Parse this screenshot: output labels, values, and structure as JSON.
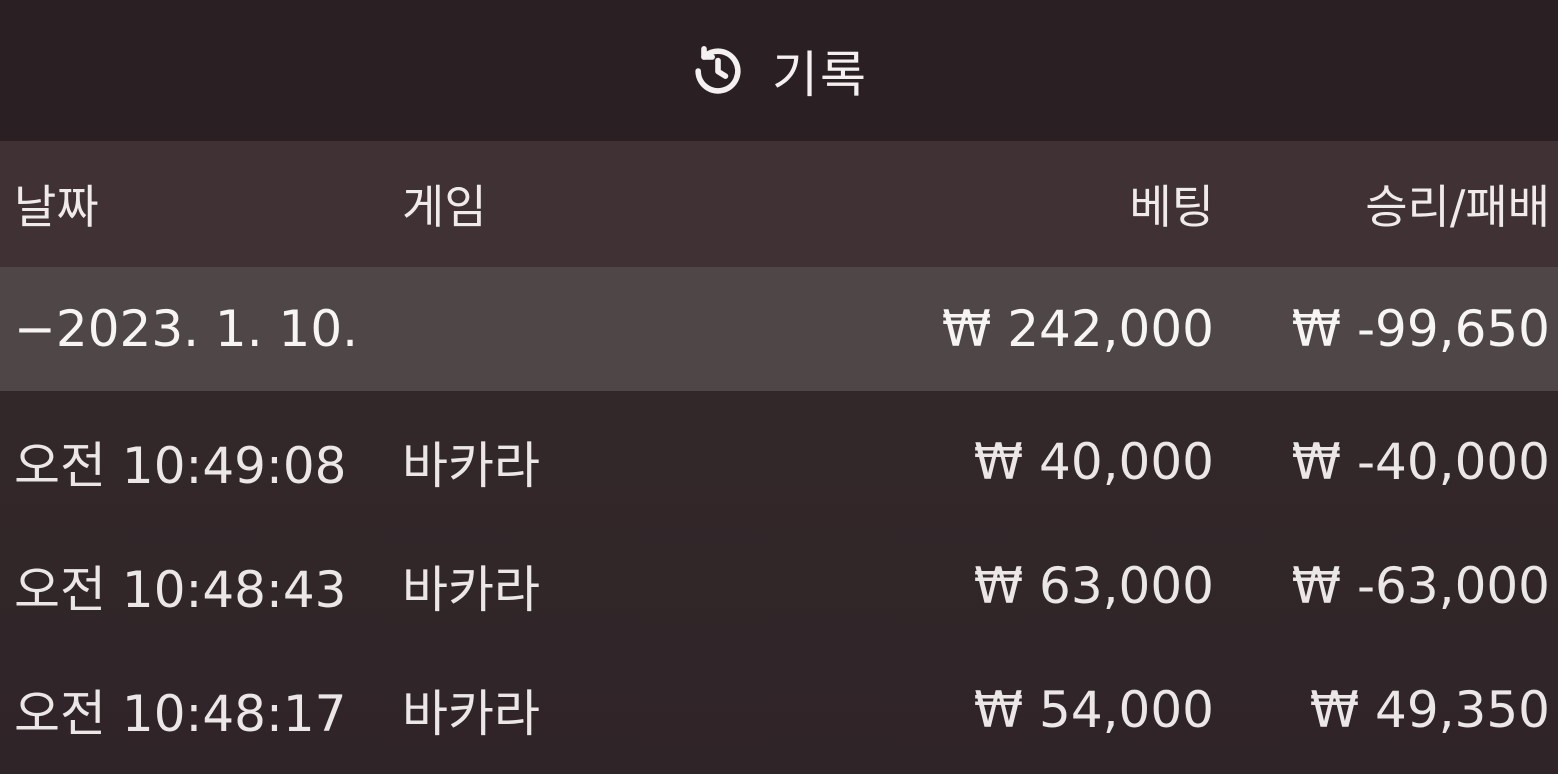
{
  "header": {
    "title": "기록",
    "icon": "history-icon"
  },
  "columns": {
    "date": "날짜",
    "game": "게임",
    "bet": "베팅",
    "result": "승리/패배"
  },
  "summary": {
    "date": "−2023. 1. 10.",
    "game": "",
    "bet": "₩ 242,000",
    "result": "₩ -99,650"
  },
  "rows": [
    {
      "time": "오전 10:49:08",
      "game": "바카라",
      "bet": "₩ 40,000",
      "result": "₩ -40,000"
    },
    {
      "time": "오전 10:48:43",
      "game": "바카라",
      "bet": "₩ 63,000",
      "result": "₩ -63,000"
    },
    {
      "time": "오전 10:48:17",
      "game": "바카라",
      "bet": "₩ 54,000",
      "result": "₩ 49,350"
    }
  ],
  "colors": {
    "background": "#2e2326",
    "header_bg": "#2a2023",
    "column_header_bg": "#3f3134",
    "summary_row_bg": "#4f4747",
    "text": "#f2eeee"
  }
}
